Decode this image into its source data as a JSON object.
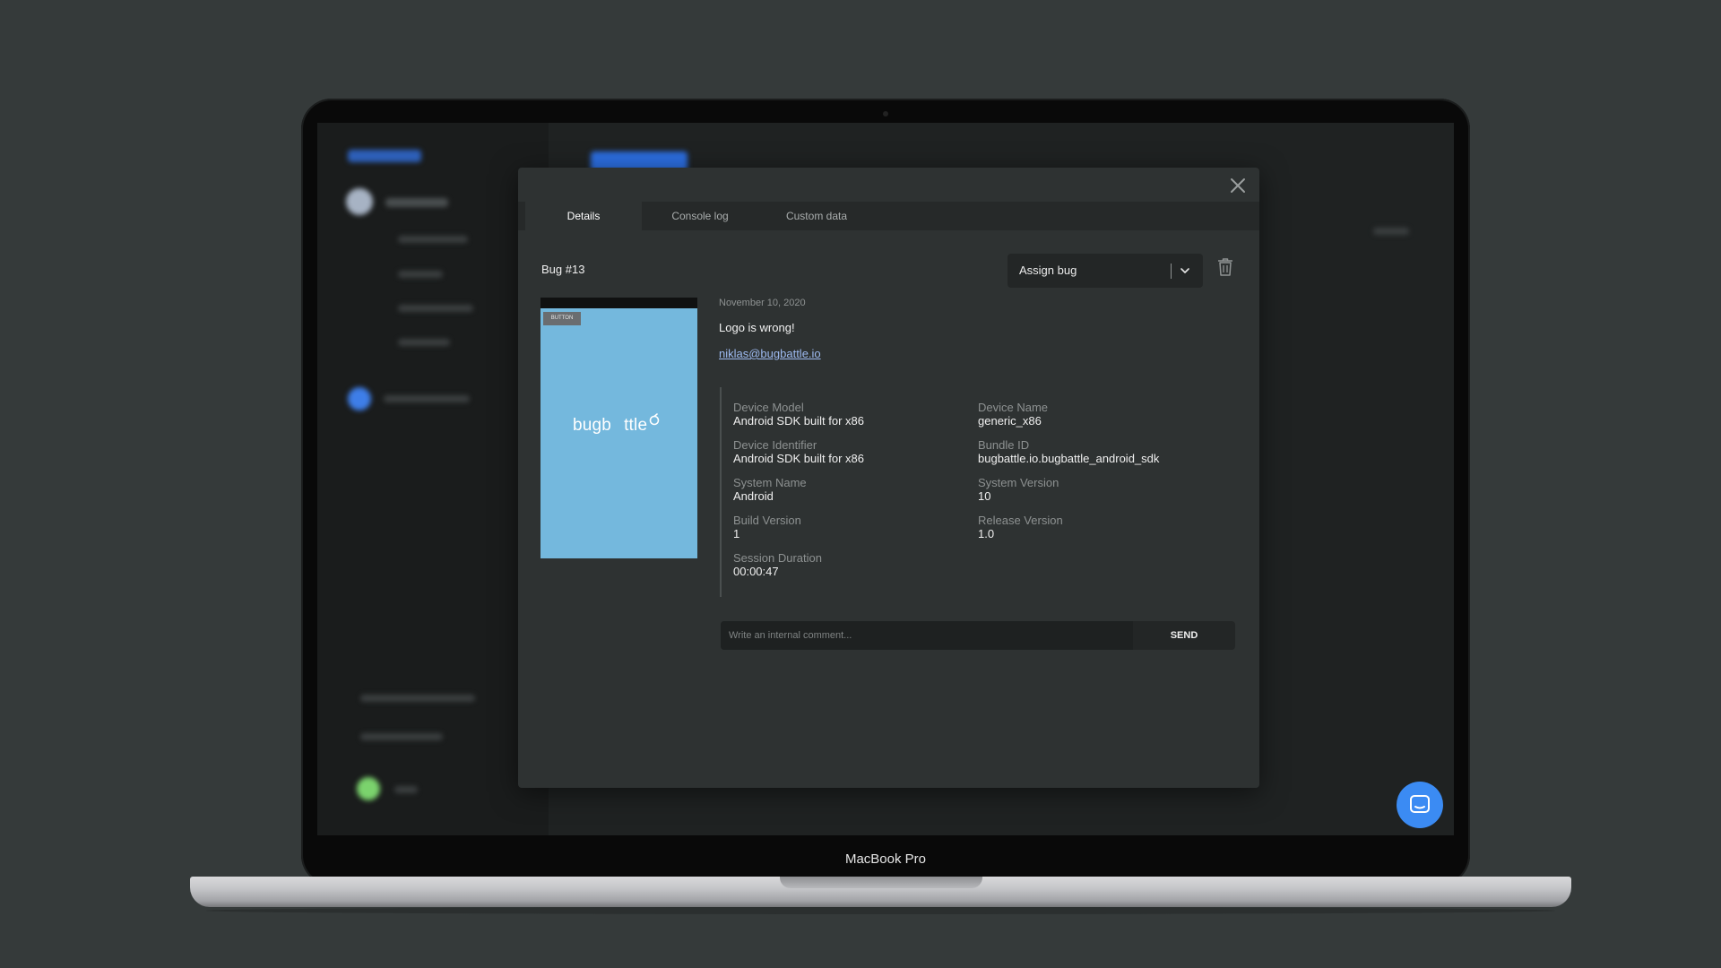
{
  "device": {
    "label": "MacBook Pro"
  },
  "modal": {
    "tabs": [
      {
        "label": "Details",
        "active": true
      },
      {
        "label": "Console log",
        "active": false
      },
      {
        "label": "Custom data",
        "active": false
      }
    ],
    "bug_title": "Bug #13",
    "assign": {
      "label": "Assign bug"
    },
    "screenshot": {
      "badge": "BUTTON",
      "logo_left": "bugb",
      "logo_right": "ttle"
    },
    "date": "November 10, 2020",
    "summary": "Logo is wrong!",
    "reporter_email": "niklas@bugbattle.io",
    "fields": [
      {
        "label": "Device Model",
        "value": "Android SDK built for x86"
      },
      {
        "label": "Device Name",
        "value": "generic_x86"
      },
      {
        "label": "Device Identifier",
        "value": "Android SDK built for x86"
      },
      {
        "label": "Bundle ID",
        "value": "bugbattle.io.bugbattle_android_sdk"
      },
      {
        "label": "System Name",
        "value": "Android"
      },
      {
        "label": "System Version",
        "value": "10"
      },
      {
        "label": "Build Version",
        "value": "1"
      },
      {
        "label": "Release Version",
        "value": "1.0"
      },
      {
        "label": "Session Duration",
        "value": "00:00:47"
      }
    ],
    "comment": {
      "placeholder": "Write an internal comment...",
      "value": "",
      "send_label": "SEND"
    }
  },
  "colors": {
    "accent": "#3b8bf3",
    "screenshot_bg": "#74b8dd",
    "link": "#9dbaf0"
  },
  "icons": [
    "close-icon",
    "chevron-down-icon",
    "trash-icon",
    "chat-icon"
  ]
}
